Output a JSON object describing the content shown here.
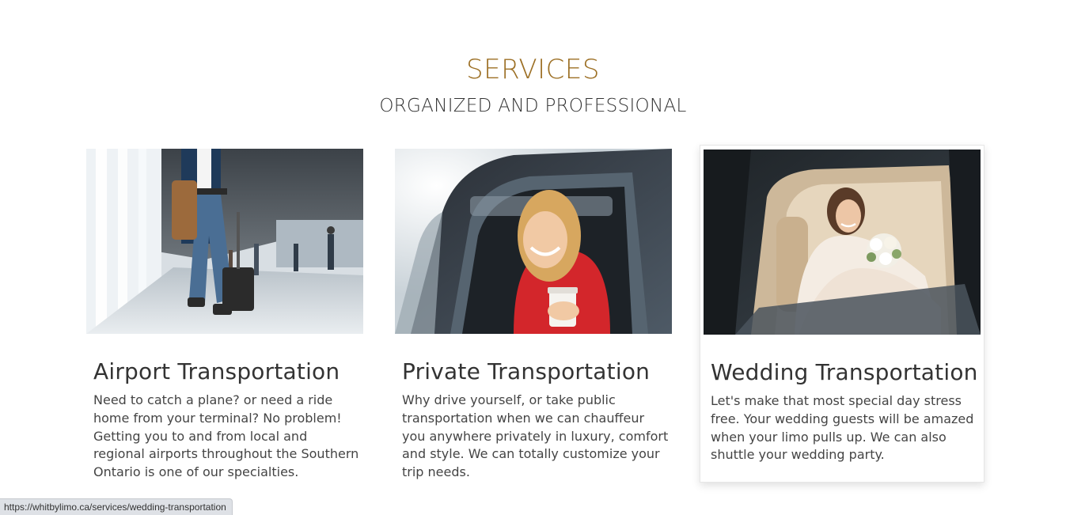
{
  "section": {
    "title": "SERVICES",
    "subtitle": "ORGANIZED AND PROFESSIONAL"
  },
  "services": [
    {
      "title": "Airport Transportation",
      "description": "Need to catch a plane? or need a ride home from your terminal? No problem! Getting you to and from local and regional airports throughout the Southern Ontario is one of our specialties.",
      "image": "airport-traveler-photo"
    },
    {
      "title": "Private Transportation",
      "description": "Why drive yourself, or take public transportation when we can chauffeur you anywhere privately in luxury, comfort and style. We can totally customize your trip needs.",
      "image": "woman-in-car-photo"
    },
    {
      "title": "Wedding Transportation",
      "description": "Let's make that most special day stress free. Your wedding guests will be amazed when your limo pulls up. We can also shuttle your wedding party.",
      "image": "bride-in-limo-photo"
    }
  ],
  "status_bar": {
    "url": "https://whitbylimo.ca/services/wedding-transportation"
  },
  "colors": {
    "accent": "#9c6f24",
    "text": "#333333"
  }
}
